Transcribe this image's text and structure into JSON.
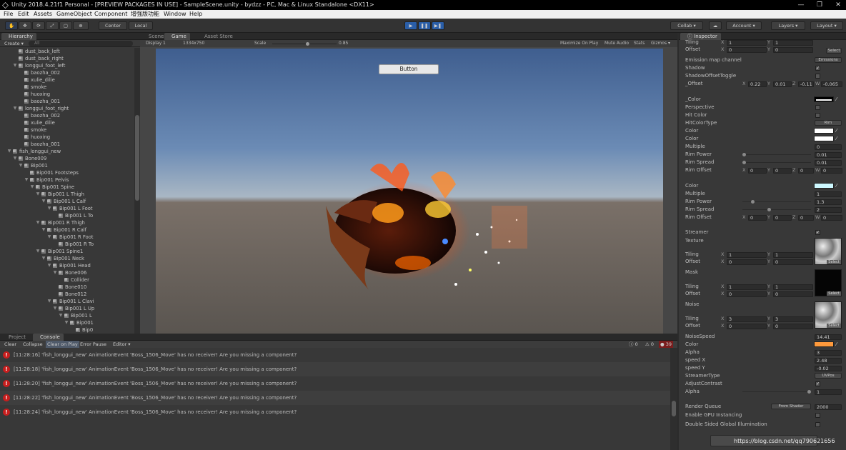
{
  "window": {
    "title": "Unity 2018.4.21f1 Personal - [PREVIEW PACKAGES IN USE] - SampleScene.unity - bydzz - PC, Mac & Linux Standalone <DX11>",
    "min": "—",
    "max": "❐",
    "close": "✕"
  },
  "menu": [
    "File",
    "Edit",
    "Assets",
    "GameObject",
    "Component",
    "增强版功能",
    "Window",
    "Help"
  ],
  "toolbar": {
    "center": "Center",
    "local": "Local",
    "collab": "Collab ▾",
    "account": "Account ▾",
    "layers": "Layers ▾",
    "layout": "Layout ▾"
  },
  "hierarchy": {
    "tab": "Hierarchy",
    "create": "Create ▾",
    "search_placeholder": "All",
    "items": [
      {
        "label": "dust_back_left",
        "depth": 4,
        "arrow": ""
      },
      {
        "label": "dust_back_right",
        "depth": 4,
        "arrow": ""
      },
      {
        "label": "longgui_foot_left",
        "depth": 4,
        "arrow": "▼"
      },
      {
        "label": "baozha_002",
        "depth": 5,
        "arrow": ""
      },
      {
        "label": "xulie_dilie",
        "depth": 5,
        "arrow": ""
      },
      {
        "label": "smoke",
        "depth": 5,
        "arrow": ""
      },
      {
        "label": "huoxing",
        "depth": 5,
        "arrow": ""
      },
      {
        "label": "baozha_001",
        "depth": 5,
        "arrow": ""
      },
      {
        "label": "longgui_foot_right",
        "depth": 4,
        "arrow": "▼"
      },
      {
        "label": "baozha_002",
        "depth": 5,
        "arrow": ""
      },
      {
        "label": "xulie_dilie",
        "depth": 5,
        "arrow": ""
      },
      {
        "label": "smoke",
        "depth": 5,
        "arrow": ""
      },
      {
        "label": "huoxing",
        "depth": 5,
        "arrow": ""
      },
      {
        "label": "baozha_001",
        "depth": 5,
        "arrow": ""
      },
      {
        "label": "fish_longgui_new",
        "depth": 3,
        "arrow": "▼"
      },
      {
        "label": "Bone009",
        "depth": 4,
        "arrow": "▼"
      },
      {
        "label": "Bip001",
        "depth": 5,
        "arrow": "▼"
      },
      {
        "label": "Bip001 Footsteps",
        "depth": 6,
        "arrow": ""
      },
      {
        "label": "Bip001 Pelvis",
        "depth": 6,
        "arrow": "▼"
      },
      {
        "label": "Bip001 Spine",
        "depth": 7,
        "arrow": "▼"
      },
      {
        "label": "Bip001 L Thigh",
        "depth": 8,
        "arrow": "▼"
      },
      {
        "label": "Bip001 L Calf",
        "depth": 9,
        "arrow": "▼"
      },
      {
        "label": "Bip001 L Foot",
        "depth": 10,
        "arrow": "▼"
      },
      {
        "label": "Bip001 L To",
        "depth": 11,
        "arrow": ""
      },
      {
        "label": "Bip001 R Thigh",
        "depth": 8,
        "arrow": "▼"
      },
      {
        "label": "Bip001 R Calf",
        "depth": 9,
        "arrow": "▼"
      },
      {
        "label": "Bip001 R Foot",
        "depth": 10,
        "arrow": "▼"
      },
      {
        "label": "Bip001 R To",
        "depth": 11,
        "arrow": ""
      },
      {
        "label": "Bip001 Spine1",
        "depth": 8,
        "arrow": "▼"
      },
      {
        "label": "Bip001 Neck",
        "depth": 9,
        "arrow": "▼"
      },
      {
        "label": "Bip001 Head",
        "depth": 10,
        "arrow": "▼"
      },
      {
        "label": "Bone006",
        "depth": 11,
        "arrow": "▼"
      },
      {
        "label": "Collider",
        "depth": 12,
        "arrow": ""
      },
      {
        "label": "Bone010",
        "depth": 11,
        "arrow": ""
      },
      {
        "label": "Bone012",
        "depth": 11,
        "arrow": ""
      },
      {
        "label": "Bip001 L Clavi",
        "depth": 10,
        "arrow": "▼"
      },
      {
        "label": "Bip001 L Up",
        "depth": 11,
        "arrow": "▼"
      },
      {
        "label": "Bip001 L",
        "depth": 12,
        "arrow": "▼"
      },
      {
        "label": "Bip001",
        "depth": 13,
        "arrow": "▼"
      },
      {
        "label": "Bip0",
        "depth": 14,
        "arrow": ""
      }
    ]
  },
  "scene_tabs": [
    "Scene",
    "Game",
    "Asset Store"
  ],
  "game": {
    "display": "Display 1",
    "resolution": "1334x750",
    "scale_label": "Scale",
    "scale_value": "0.85",
    "scale_fraction": 0.55,
    "opts": [
      "Maximize On Play",
      "Mute Audio",
      "Stats",
      "Gizmos ▾"
    ],
    "ui_button": "Button"
  },
  "bottom_tabs": [
    "Project",
    "Console"
  ],
  "console": {
    "buttons": [
      "Clear",
      "Collapse",
      "Clear on Play",
      "Error Pause",
      "Editor ▾"
    ],
    "info": "0",
    "warn": "0",
    "err": "39",
    "messages": [
      "[11:28:16] 'fish_longgui_new' AnimationEvent 'Boss_1506_Move' has no receiver! Are you missing a component?",
      "[11:28:18] 'fish_longgui_new' AnimationEvent 'Boss_1506_Move' has no receiver! Are you missing a component?",
      "[11:28:20] 'fish_longgui_new' AnimationEvent 'Boss_1506_Move' has no receiver! Are you missing a component?",
      "[11:28:22] 'fish_longgui_new' AnimationEvent 'Boss_1506_Move' has no receiver! Are you missing a component?",
      "[11:28:24] 'fish_longgui_new' AnimationEvent 'Boss_1506_Move' has no receiver! Are you missing a component?"
    ]
  },
  "inspector": {
    "tab": "Inspector",
    "select": "Select",
    "tiling": "Tiling",
    "offset": "Offset",
    "t1": {
      "x": "1",
      "y": "1"
    },
    "o1": {
      "x": "0",
      "y": "0"
    },
    "emission": "Emission map channel",
    "emission_val": "Emissions",
    "shadow": "Shadow",
    "shadow_toggle": "ShadowOffsetToggle",
    "offset_label": "_Offset",
    "offset_vals": {
      "x": "0.22",
      "y": "0.01",
      "z": "-0.11",
      "w": "-0.065"
    },
    "color_label": "_Color",
    "perspective": "Perspective",
    "hit_color": "Hit Color",
    "hit_type": "HitColorType",
    "hit_type_val": "Rim",
    "color": "Color",
    "multiple": "Multiple",
    "multiple_val": "0",
    "rim_power": "Rim Power",
    "rim_power_val": "0.01",
    "rim_power_frac": 0.0,
    "rim_spread": "Rim Spread",
    "rim_spread_val": "0.01",
    "rim_spread_frac": 0.0,
    "rim_offset": "Rim Offset",
    "rim_offset_vals": {
      "x": "0",
      "y": "0",
      "z": "0",
      "w": "0"
    },
    "multiple2_val": "1",
    "rim_power2_val": "1.3",
    "rim_power2_frac": 0.13,
    "rim_spread2_val": "2",
    "rim_spread2_frac": 0.38,
    "rim_offset2_vals": {
      "x": "0",
      "y": "0",
      "z": "0",
      "w": "0"
    },
    "streamer": "Streamer",
    "texture": "Texture",
    "t2": {
      "x": "1",
      "y": "1"
    },
    "o2": {
      "x": "0",
      "y": "0"
    },
    "mask": "Mask",
    "t3": {
      "x": "1",
      "y": "1"
    },
    "o3": {
      "x": "0",
      "y": "0"
    },
    "noise": "Noise",
    "t4": {
      "x": "3",
      "y": "3"
    },
    "o4": {
      "x": "0",
      "y": "0"
    },
    "noise_speed": "NoiseSpeed",
    "noise_speed_val": "14.41",
    "alpha": "Alpha",
    "alpha_val": "3",
    "speed_x": "speed X",
    "speed_x_val": "2.48",
    "speed_y": "speed Y",
    "speed_y_val": "-0.02",
    "streamer_type": "StreamerType",
    "streamer_type_val": "UVPos",
    "adjust": "AdjustContrast",
    "alpha2_val": "1",
    "alpha2_frac": 1.0,
    "render_queue": "Render Queue",
    "render_queue_pop": "From Shader",
    "render_queue_val": "2000",
    "gpu": "Enable GPU Instancing",
    "double": "Double Sided Global Illumination"
  },
  "colors": {
    "white": "#ffffff",
    "cyan": "#cdf8ff",
    "orange": "#ff9a3c",
    "play_blue": "#3a7fd5"
  },
  "watermark": "https://blog.csdn.net/qq790621656"
}
